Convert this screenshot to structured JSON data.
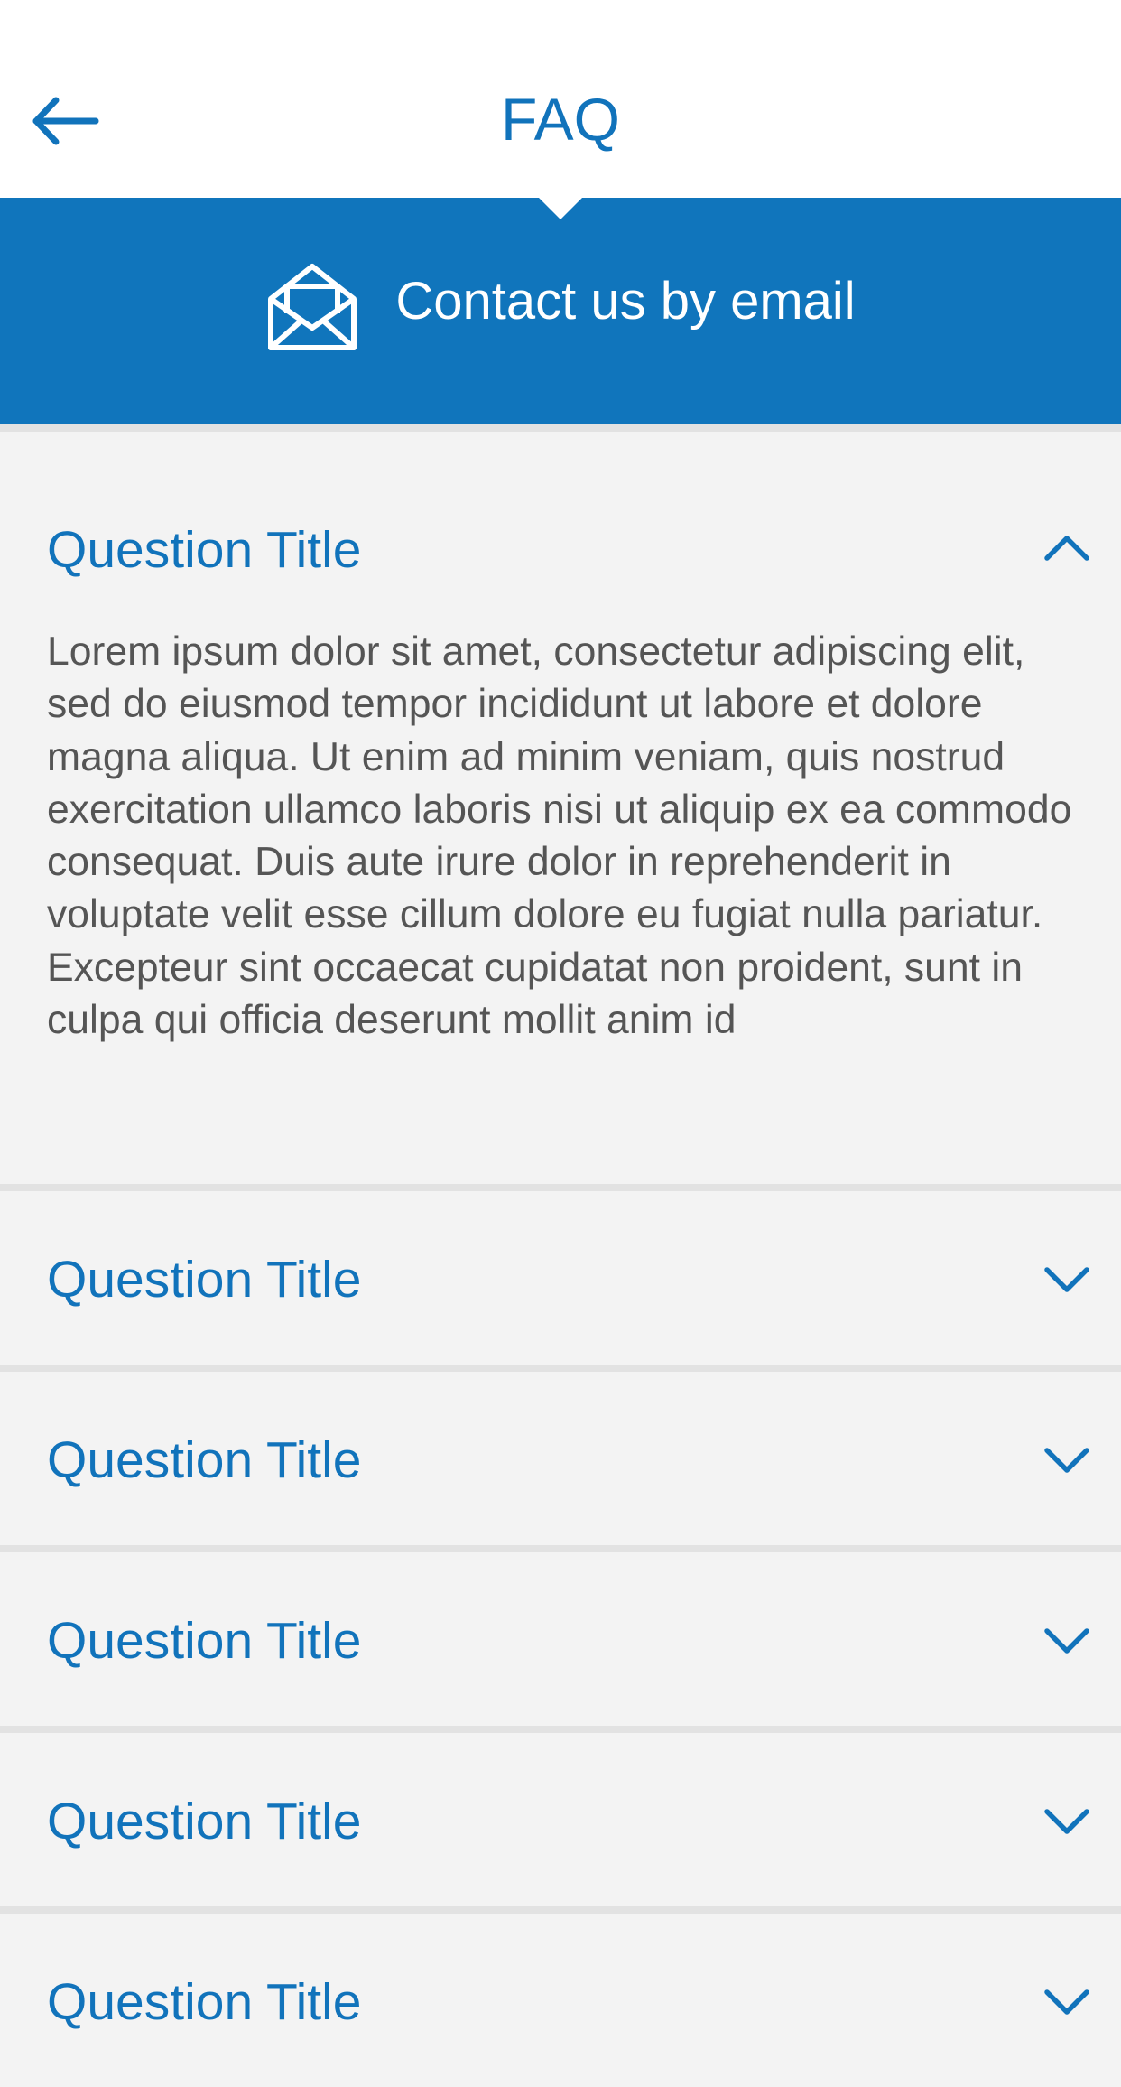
{
  "header": {
    "title": "FAQ",
    "back_icon": "arrow-left-icon"
  },
  "contact": {
    "label": "Contact us by email",
    "icon": "open-envelope-icon"
  },
  "colors": {
    "primary": "#1075bc",
    "background": "#f3f3f3",
    "divider": "#e2e2e2",
    "body_text": "#555555"
  },
  "faq": {
    "items": [
      {
        "question": "Question Title",
        "expanded": true,
        "answer": "Lorem ipsum dolor sit amet, consectetur adipiscing elit, sed do eiusmod tempor incididunt ut labore et dolore magna aliqua. Ut enim ad minim veniam, quis nostrud exercitation ullamco laboris nisi ut aliquip ex ea commodo consequat. Duis aute irure dolor in reprehenderit in voluptate velit esse cillum dolore eu fugiat nulla pariatur. Excepteur sint occaecat cupidatat non proident, sunt in culpa qui officia deserunt mollit anim id",
        "icon": "chevron-up-icon"
      },
      {
        "question": "Question Title",
        "expanded": false,
        "icon": "chevron-down-icon"
      },
      {
        "question": "Question Title",
        "expanded": false,
        "icon": "chevron-down-icon"
      },
      {
        "question": "Question Title",
        "expanded": false,
        "icon": "chevron-down-icon"
      },
      {
        "question": "Question Title",
        "expanded": false,
        "icon": "chevron-down-icon"
      },
      {
        "question": "Question Title",
        "expanded": false,
        "icon": "chevron-down-icon"
      }
    ]
  }
}
